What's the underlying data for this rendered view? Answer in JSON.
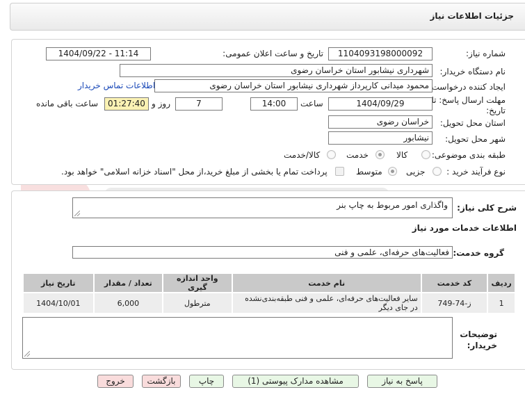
{
  "page_title": "جزئیات اطلاعات نیاز",
  "form": {
    "need_number_label": "شماره نیاز:",
    "need_number": "1104093198000092",
    "announce_datetime_label": "تاریخ و ساعت اعلان عمومی:",
    "announce_datetime": "1404/09/22 - 11:14",
    "buyer_org_label": "نام دستگاه خریدار:",
    "buyer_org": "شهرداری نیشابور استان خراسان رضوی",
    "requester_label": "ایجاد کننده درخواست:",
    "requester": "محمود میدانی کارپرداز شهرداری نیشابور استان خراسان رضوی",
    "contact_link": "اطلاعات تماس خریدار",
    "deadline_label_line1": "مهلت ارسال پاسخ: تا",
    "deadline_label_line2": "تاریخ:",
    "deadline_date": "1404/09/29",
    "time_label": "ساعت",
    "deadline_time": "14:00",
    "days_count": "7",
    "days_label": "روز و",
    "remaining_time": "01:27:40",
    "remaining_label": "ساعت باقی مانده",
    "province_label": "استان محل تحویل:",
    "province": "خراسان رضوی",
    "city_label": "شهر محل تحویل:",
    "city": "نیشابور",
    "category_label": "طبقه بندی موضوعی:",
    "category_options": [
      "کالا",
      "خدمت",
      "کالا/خدمت"
    ],
    "category_selected": "خدمت",
    "process_label": "نوع فرآیند خرید :",
    "process_options": [
      "جزیی",
      "متوسط"
    ],
    "process_selected": "متوسط",
    "payment_note": "پرداخت تمام یا بخشی از مبلغ خرید،از محل \"اسناد خزانه اسلامی\" خواهد بود."
  },
  "summary": {
    "general_desc_label": "شرح کلی نیاز:",
    "general_desc": "واگذاری امور مربوط به چاپ بنر",
    "services_heading": "اطلاعات خدمات مورد نیاز",
    "service_group_label": "گروه خدمت:",
    "service_group": "فعالیت‌های حرفه‌ای، علمی و فنی"
  },
  "table": {
    "headers": [
      "ردیف",
      "کد خدمت",
      "نام خدمت",
      "واحد اندازه گیری",
      "تعداد / مقدار",
      "تاریخ نیاز"
    ],
    "rows": [
      {
        "row": "1",
        "code": "ز-74-749",
        "name": "سایر فعالیت‌های حرفه‌ای، علمی و فنی طبقه‌بندی‌نشده در جای دیگر",
        "unit": "مترطول",
        "qty": "6,000",
        "date": "1404/10/01"
      }
    ]
  },
  "buyer_notes_label_line1": "توضیحات",
  "buyer_notes_label_line2": "خریدار:",
  "buttons": {
    "reply": "پاسخ به نیاز",
    "attachments": "مشاهده مدارک پیوستی (1)",
    "print": "چاپ",
    "back": "بازگشت",
    "exit": "خروج"
  },
  "colors": {
    "yellow_field": "#fbf2b4",
    "green_button": "#e8f7e5",
    "pink_button": "#f9dcdc",
    "link": "#1a49b8"
  }
}
